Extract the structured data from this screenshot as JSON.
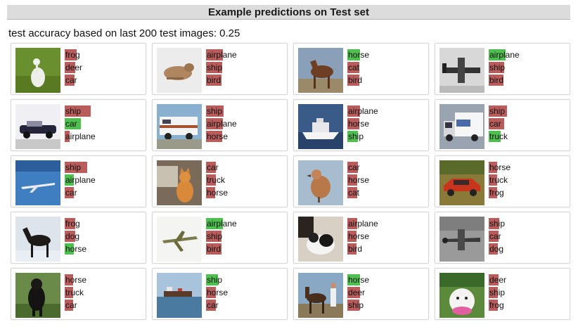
{
  "header": {
    "title": "Example predictions on Test set"
  },
  "summary": {
    "accuracy_text": "test accuracy based on last 200 test images: 0.25"
  },
  "colors": {
    "wrong": "#b85c5c",
    "right": "#4fbf4f",
    "header_bg": "#dcdcdc"
  },
  "cards": [
    {
      "scene": "frog-bird",
      "predictions": [
        {
          "label": "frog",
          "prob": 0.15,
          "correct": false
        },
        {
          "label": "deer",
          "prob": 0.14,
          "correct": false
        },
        {
          "label": "car",
          "prob": 0.13,
          "correct": false
        }
      ]
    },
    {
      "scene": "dog-sleeping",
      "predictions": [
        {
          "label": "airplane",
          "prob": 0.22,
          "correct": false
        },
        {
          "label": "ship",
          "prob": 0.21,
          "correct": false
        },
        {
          "label": "bird",
          "prob": 0.2,
          "correct": false
        }
      ]
    },
    {
      "scene": "horse-brown",
      "predictions": [
        {
          "label": "horse",
          "prob": 0.16,
          "correct": true
        },
        {
          "label": "cat",
          "prob": 0.15,
          "correct": false
        },
        {
          "label": "bird",
          "prob": 0.15,
          "correct": false
        }
      ]
    },
    {
      "scene": "airplane-bw",
      "predictions": [
        {
          "label": "airplane",
          "prob": 0.22,
          "correct": true
        },
        {
          "label": "ship",
          "prob": 0.2,
          "correct": false
        },
        {
          "label": "bird",
          "prob": 0.19,
          "correct": false
        }
      ]
    },
    {
      "scene": "car-convertible",
      "predictions": [
        {
          "label": "ship",
          "prob": 0.34,
          "correct": false
        },
        {
          "label": "car",
          "prob": 0.21,
          "correct": true
        },
        {
          "label": "airplane",
          "prob": 0.06,
          "correct": false
        }
      ]
    },
    {
      "scene": "rv-truck",
      "predictions": [
        {
          "label": "ship",
          "prob": 0.23,
          "correct": false
        },
        {
          "label": "airplane",
          "prob": 0.22,
          "correct": false
        },
        {
          "label": "horse",
          "prob": 0.21,
          "correct": false
        }
      ]
    },
    {
      "scene": "ship-boat",
      "predictions": [
        {
          "label": "airplane",
          "prob": 0.16,
          "correct": false
        },
        {
          "label": "horse",
          "prob": 0.15,
          "correct": false
        },
        {
          "label": "ship",
          "prob": 0.14,
          "correct": true
        }
      ]
    },
    {
      "scene": "truck-white",
      "predictions": [
        {
          "label": "ship",
          "prob": 0.24,
          "correct": false
        },
        {
          "label": "car",
          "prob": 0.2,
          "correct": false
        },
        {
          "label": "truck",
          "prob": 0.15,
          "correct": true
        }
      ]
    },
    {
      "scene": "airplane-sky",
      "predictions": [
        {
          "label": "ship",
          "prob": 0.29,
          "correct": false
        },
        {
          "label": "airplane",
          "prob": 0.12,
          "correct": true
        },
        {
          "label": "car",
          "prob": 0.12,
          "correct": false
        }
      ]
    },
    {
      "scene": "cat-orange",
      "predictions": [
        {
          "label": "car",
          "prob": 0.13,
          "correct": false
        },
        {
          "label": "truck",
          "prob": 0.13,
          "correct": false
        },
        {
          "label": "horse",
          "prob": 0.12,
          "correct": false
        }
      ]
    },
    {
      "scene": "bird-brown",
      "predictions": [
        {
          "label": "car",
          "prob": 0.14,
          "correct": false
        },
        {
          "label": "horse",
          "prob": 0.13,
          "correct": false
        },
        {
          "label": "cat",
          "prob": 0.13,
          "correct": false
        }
      ]
    },
    {
      "scene": "car-red",
      "predictions": [
        {
          "label": "horse",
          "prob": 0.11,
          "correct": false
        },
        {
          "label": "truck",
          "prob": 0.11,
          "correct": false
        },
        {
          "label": "frog",
          "prob": 0.11,
          "correct": false
        }
      ]
    },
    {
      "scene": "horse-dark",
      "predictions": [
        {
          "label": "frog",
          "prob": 0.14,
          "correct": false
        },
        {
          "label": "dog",
          "prob": 0.14,
          "correct": false
        },
        {
          "label": "horse",
          "prob": 0.12,
          "correct": true
        }
      ]
    },
    {
      "scene": "airplane-jet",
      "predictions": [
        {
          "label": "airplane",
          "prob": 0.22,
          "correct": true
        },
        {
          "label": "ship",
          "prob": 0.2,
          "correct": false
        },
        {
          "label": "bird",
          "prob": 0.2,
          "correct": false
        }
      ]
    },
    {
      "scene": "dog-bw",
      "predictions": [
        {
          "label": "airplane",
          "prob": 0.13,
          "correct": false
        },
        {
          "label": "horse",
          "prob": 0.12,
          "correct": false
        },
        {
          "label": "bird",
          "prob": 0.12,
          "correct": false
        }
      ]
    },
    {
      "scene": "airplane-gray",
      "predictions": [
        {
          "label": "ship",
          "prob": 0.14,
          "correct": false
        },
        {
          "label": "car",
          "prob": 0.13,
          "correct": false
        },
        {
          "label": "dog",
          "prob": 0.12,
          "correct": false
        }
      ]
    },
    {
      "scene": "dog-black",
      "predictions": [
        {
          "label": "horse",
          "prob": 0.11,
          "correct": false
        },
        {
          "label": "truck",
          "prob": 0.11,
          "correct": false
        },
        {
          "label": "car",
          "prob": 0.11,
          "correct": false
        }
      ]
    },
    {
      "scene": "ship-sea",
      "predictions": [
        {
          "label": "ship",
          "prob": 0.15,
          "correct": true
        },
        {
          "label": "horse",
          "prob": 0.13,
          "correct": false
        },
        {
          "label": "car",
          "prob": 0.13,
          "correct": false
        }
      ]
    },
    {
      "scene": "horse-person",
      "predictions": [
        {
          "label": "horse",
          "prob": 0.16,
          "correct": true
        },
        {
          "label": "deer",
          "prob": 0.16,
          "correct": false
        },
        {
          "label": "ship",
          "prob": 0.15,
          "correct": false
        }
      ]
    },
    {
      "scene": "dog-white",
      "predictions": [
        {
          "label": "deer",
          "prob": 0.13,
          "correct": false
        },
        {
          "label": "ship",
          "prob": 0.12,
          "correct": false
        },
        {
          "label": "frog",
          "prob": 0.12,
          "correct": false
        }
      ]
    }
  ]
}
